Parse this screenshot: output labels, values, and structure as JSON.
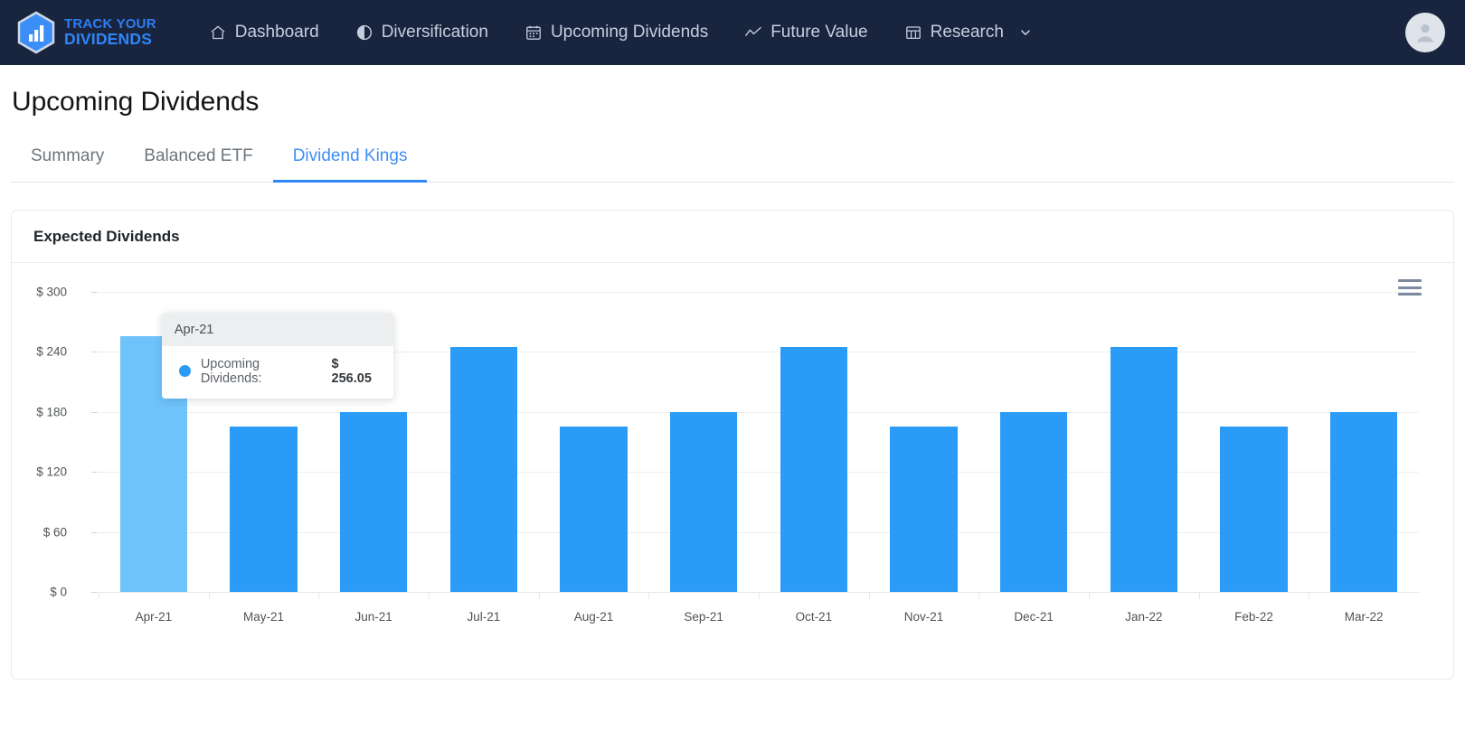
{
  "navbar": {
    "brand": {
      "line1": "TRACK YOUR",
      "line2": "DIVIDENDS",
      "logo_icon": "hexagon-bar-chart-icon"
    },
    "items": [
      {
        "label": "Dashboard",
        "icon": "home-icon"
      },
      {
        "label": "Diversification",
        "icon": "pie-chart-icon"
      },
      {
        "label": "Upcoming Dividends",
        "icon": "calendar-icon"
      },
      {
        "label": "Future Value",
        "icon": "line-chart-icon"
      },
      {
        "label": "Research",
        "icon": "table-icon",
        "has_chevron": true
      }
    ],
    "avatar_icon": "user-avatar-icon",
    "background_color": "#19243f"
  },
  "page": {
    "title": "Upcoming Dividends",
    "tabs": [
      {
        "label": "Summary",
        "active": false
      },
      {
        "label": "Balanced ETF",
        "active": false
      },
      {
        "label": "Dividend Kings",
        "active": true
      }
    ],
    "active_tab_color": "#3f8ef7"
  },
  "card": {
    "title": "Expected Dividends",
    "export_icon": "hamburger-menu-icon"
  },
  "tooltip": {
    "header": "Apr-21",
    "series_label": "Upcoming Dividends:",
    "value": "$ 256.05",
    "marker_color": "#2b9bf8"
  },
  "chart_data": {
    "type": "bar",
    "title": "Expected Dividends",
    "xlabel": "",
    "ylabel": "",
    "categories": [
      "Apr-21",
      "May-21",
      "Jun-21",
      "Jul-21",
      "Aug-21",
      "Sep-21",
      "Oct-21",
      "Nov-21",
      "Dec-21",
      "Jan-22",
      "Feb-22",
      "Mar-22"
    ],
    "series": [
      {
        "name": "Upcoming Dividends",
        "values": [
          256.05,
          165,
          180,
          245,
          165,
          180,
          245,
          165,
          180,
          245,
          165,
          180
        ],
        "color": "#2b9bf8",
        "highlight_color": "#6ec3fa",
        "highlighted_index": 0
      }
    ],
    "ylim": [
      0,
      300
    ],
    "yticks": [
      0,
      60,
      120,
      180,
      240,
      300
    ],
    "ytick_labels": [
      "$ 0",
      "$ 60",
      "$ 120",
      "$ 180",
      "$ 240",
      "$ 300"
    ],
    "grid": true,
    "legend": false
  }
}
